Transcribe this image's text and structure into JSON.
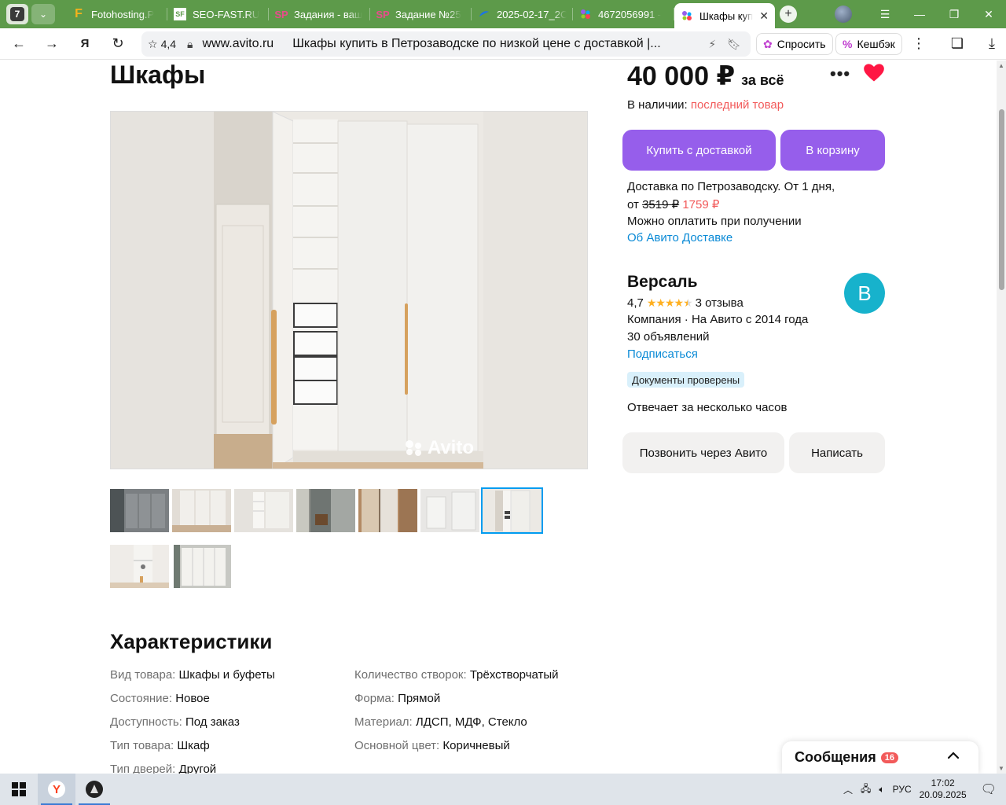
{
  "browser": {
    "tab_count": "7",
    "tabs": [
      {
        "title": "Fotohosting.P",
        "icon": "F",
        "color": "#f6b21b"
      },
      {
        "title": "SEO-FAST.RU",
        "icon": "SF",
        "color": "#ffffff"
      },
      {
        "title": "Задания - ваш",
        "icon": "SP",
        "color": "#e84c8b"
      },
      {
        "title": "Задание №25",
        "icon": "SP",
        "color": "#e84c8b"
      },
      {
        "title": "2025-02-17_2C",
        "icon": "cloud",
        "color": "#1a73e8"
      },
      {
        "title": "4672056991 -",
        "icon": "avito",
        "color": "#965eeb"
      },
      {
        "title": "Шкафы куп",
        "icon": "avito",
        "color": "#965eeb"
      }
    ],
    "omnibox": {
      "rating": "4,4",
      "domain": "www.avito.ru",
      "page_title": "Шкафы купить в Петрозаводске по низкой цене с доставкой |..."
    },
    "ask_label": "Спросить",
    "cashback_label": "Кешбэк"
  },
  "listing": {
    "title": "Шкафы",
    "photo_watermark": "Avito",
    "thumbnails_count": 9,
    "active_thumbnail": 6
  },
  "price": {
    "amount": "40 000 ₽",
    "suffix": "за всё",
    "availability_label": "В наличии:",
    "availability_value": "последний товар"
  },
  "actions": {
    "buy_delivery": "Купить с доставкой",
    "to_cart": "В корзину",
    "call": "Позвонить через Авито",
    "write": "Написать"
  },
  "delivery": {
    "line1": "Доставка по Петрозаводску. От 1 дня,",
    "from_label": "от",
    "old_price": "3519 ₽",
    "new_price": "1759 ₽",
    "payment": "Можно оплатить при получении",
    "about_link": "Об Авито Доставке"
  },
  "seller": {
    "name": "Версаль",
    "avatar_letter": "В",
    "rating": "4,7",
    "stars": 4.5,
    "reviews": "3 отзыва",
    "info": "Компания · На Авито с 2014 года",
    "ads_count": "30 объявлений",
    "subscribe": "Подписаться",
    "badge": "Документы проверены",
    "response": "Отвечает за несколько часов"
  },
  "specs": {
    "title": "Характеристики",
    "left": [
      {
        "k": "Вид товара:",
        "v": "Шкафы и буфеты"
      },
      {
        "k": "Состояние:",
        "v": "Новое"
      },
      {
        "k": "Доступность:",
        "v": "Под заказ"
      },
      {
        "k": "Тип товара:",
        "v": "Шкаф"
      },
      {
        "k": "Тип дверей:",
        "v": "Другой"
      }
    ],
    "right": [
      {
        "k": "Количество створок:",
        "v": "Трёхстворчатый"
      },
      {
        "k": "Форма:",
        "v": "Прямой"
      },
      {
        "k": "Материал:",
        "v": "ЛДСП, МДФ, Стекло"
      },
      {
        "k": "Основной цвет:",
        "v": "Коричневый"
      }
    ]
  },
  "messages": {
    "label": "Сообщения",
    "count": "16"
  },
  "taskbar": {
    "language": "РУС",
    "time": "17:02",
    "date": "20.09.2025"
  },
  "colors": {
    "brand_purple": "#965eeb",
    "link_blue": "#0a8ad6",
    "accent_red": "#f25a5a",
    "browser_green": "#5d9a4a"
  }
}
